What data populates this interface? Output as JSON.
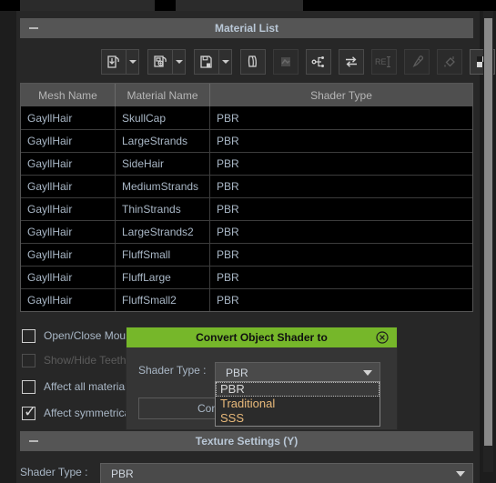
{
  "window": {
    "tabs": [
      "",
      ""
    ]
  },
  "material_list": {
    "header_title": "Material List",
    "collapse_icon": "minus-icon",
    "toolbar": [
      {
        "name": "load-material-button",
        "icon": "load-icon",
        "enabled": true,
        "has_dropdown": true
      },
      {
        "name": "save-material-button",
        "icon": "save-as-icon",
        "enabled": true,
        "has_dropdown": true
      },
      {
        "name": "save-icon-button",
        "icon": "floppy-disk-icon",
        "enabled": true,
        "has_dropdown": true
      },
      {
        "name": "copy-button",
        "icon": "copy-pages-icon",
        "enabled": true,
        "has_dropdown": false
      },
      {
        "name": "paste-button",
        "icon": "paste-icon",
        "enabled": false,
        "has_dropdown": false
      },
      {
        "name": "node-tree-button",
        "icon": "node-tree-icon",
        "enabled": true,
        "has_dropdown": false
      },
      {
        "name": "swap-button",
        "icon": "swap-arrows-icon",
        "enabled": true,
        "has_dropdown": false
      },
      {
        "name": "rename-button",
        "icon": "rename-text-icon",
        "enabled": false,
        "has_dropdown": false
      },
      {
        "name": "eyedropper-button",
        "icon": "eyedropper-icon",
        "enabled": false,
        "has_dropdown": false
      },
      {
        "name": "paint-bucket-button",
        "icon": "paint-bucket-icon",
        "enabled": false,
        "has_dropdown": false
      },
      {
        "name": "checker-button",
        "icon": "checker-pattern-icon",
        "enabled": true,
        "has_dropdown": false
      }
    ],
    "table": {
      "columns": [
        "Mesh Name",
        "Material Name",
        "Shader Type"
      ],
      "rows": [
        [
          "GayllHair",
          "SkullCap",
          "PBR"
        ],
        [
          "GayllHair",
          "LargeStrands",
          "PBR"
        ],
        [
          "GayllHair",
          "SideHair",
          "PBR"
        ],
        [
          "GayllHair",
          "MediumStrands",
          "PBR"
        ],
        [
          "GayllHair",
          "ThinStrands",
          "PBR"
        ],
        [
          "GayllHair",
          "LargeStrands2",
          "PBR"
        ],
        [
          "GayllHair",
          "FluffSmall",
          "PBR"
        ],
        [
          "GayllHair",
          "FluffLarge",
          "PBR"
        ],
        [
          "GayllHair",
          "FluffSmall2",
          "PBR"
        ]
      ]
    },
    "checkboxes": [
      {
        "label": "Open/Close Mouth",
        "checked": false,
        "enabled": true
      },
      {
        "label": "Show/Hide Teeth",
        "checked": false,
        "enabled": false
      },
      {
        "label": "Affect all materials",
        "checked": false,
        "enabled": true
      },
      {
        "label": "Affect symmetrical",
        "checked": true,
        "enabled": true
      }
    ]
  },
  "dialog": {
    "title": "Convert Object Shader to",
    "close_icon": "close-circle-icon",
    "accent_color": "#76b72a",
    "shader_label": "Shader Type :",
    "shader_value": "PBR",
    "dropdown_caret": "chevron-down-icon",
    "options": [
      "PBR",
      "Traditional",
      "SSS"
    ],
    "selected_option": "PBR",
    "convert_label": "Convert"
  },
  "texture_settings": {
    "header_title": "Texture Settings  (Y)",
    "collapse_icon": "minus-icon",
    "shader_label": "Shader Type :",
    "shader_value": "PBR",
    "dropdown_caret": "chevron-down-icon"
  }
}
